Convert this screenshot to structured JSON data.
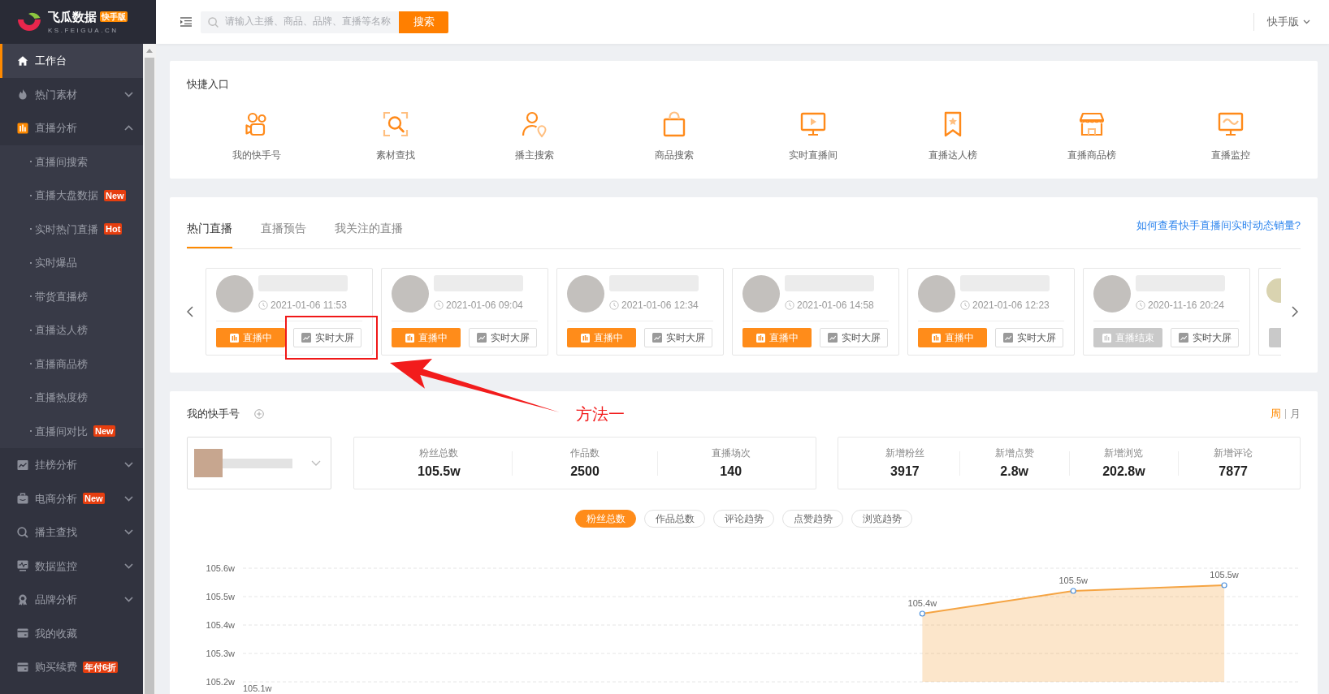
{
  "sidebar": {
    "brand": {
      "name": "飞瓜数据",
      "edition": "快手版",
      "domain": "KS.FEIGUA.CN"
    },
    "items": [
      {
        "kind": "link",
        "label": "工作台",
        "selected": true,
        "expanded": false
      },
      {
        "kind": "group",
        "label": "热门素材",
        "selected": false,
        "expanded": false
      },
      {
        "kind": "group",
        "label": "直播分析",
        "selected": false,
        "expanded": true,
        "children": [
          {
            "label": "直播间搜索",
            "selected": false
          },
          {
            "label": "直播大盘数据",
            "selected": false,
            "badge": "New"
          },
          {
            "label": "实时热门直播",
            "selected": false,
            "badge": "Hot"
          },
          {
            "label": "实时爆品",
            "selected": false
          },
          {
            "label": "带货直播榜",
            "selected": false
          },
          {
            "label": "直播达人榜",
            "selected": false
          },
          {
            "label": "直播商品榜",
            "selected": false
          },
          {
            "label": "直播热度榜",
            "selected": false
          },
          {
            "label": "直播间对比",
            "selected": false,
            "badge": "New"
          }
        ]
      },
      {
        "kind": "group",
        "label": "挂榜分析",
        "selected": false,
        "expanded": false
      },
      {
        "kind": "group",
        "label": "电商分析",
        "selected": false,
        "expanded": false,
        "badge": "New"
      },
      {
        "kind": "group",
        "label": "播主查找",
        "selected": false,
        "expanded": false
      },
      {
        "kind": "group",
        "label": "数据监控",
        "selected": false,
        "expanded": false
      },
      {
        "kind": "group",
        "label": "品牌分析",
        "selected": false,
        "expanded": false
      },
      {
        "kind": "link",
        "label": "我的收藏",
        "selected": false,
        "expanded": false
      },
      {
        "kind": "link",
        "label": "购买续费",
        "selected": false,
        "expanded": false,
        "badge": "年付6折"
      }
    ]
  },
  "topbar": {
    "search": {
      "placeholder": "请输入主播、商品、品牌、直播等名称"
    },
    "search_button": "搜索",
    "edition_menu": "快手版"
  },
  "quick_entry": {
    "title": "快捷入口",
    "items": [
      {
        "label": "我的快手号"
      },
      {
        "label": "素材查找"
      },
      {
        "label": "播主搜索"
      },
      {
        "label": "商品搜索"
      },
      {
        "label": "实时直播间"
      },
      {
        "label": "直播达人榜"
      },
      {
        "label": "直播商品榜"
      },
      {
        "label": "直播监控"
      }
    ]
  },
  "live_panel": {
    "tabs": [
      {
        "label": "热门直播",
        "selected": true
      },
      {
        "label": "直播预告",
        "selected": false
      },
      {
        "label": "我关注的直播",
        "selected": false
      }
    ],
    "help_link": "如何查看快手直播间实时动态销量?",
    "cards": [
      {
        "kind": "full",
        "time": "2021-01-06 11:53",
        "status": "直播中",
        "live": true,
        "screen_button": "实时大屏",
        "highlighted": true
      },
      {
        "kind": "full",
        "time": "2021-01-06 09:04",
        "status": "直播中",
        "live": true,
        "screen_button": "实时大屏",
        "highlighted": false
      },
      {
        "kind": "full",
        "time": "2021-01-06 12:34",
        "status": "直播中",
        "live": true,
        "screen_button": "实时大屏",
        "highlighted": false
      },
      {
        "kind": "full",
        "time": "2021-01-06 14:58",
        "status": "直播中",
        "live": true,
        "screen_button": "实时大屏",
        "highlighted": false
      },
      {
        "kind": "full",
        "time": "2021-01-06 12:23",
        "status": "直播中",
        "live": true,
        "screen_button": "实时大屏",
        "highlighted": false
      },
      {
        "kind": "full",
        "time": "2020-11-16 20:24",
        "status": "直播结束",
        "live": false,
        "screen_button": "实时大屏",
        "highlighted": false
      },
      {
        "kind": "cut",
        "live": false,
        "highlighted": false
      }
    ]
  },
  "annotation": {
    "text": "方法一"
  },
  "account_panel": {
    "title": "我的快手号",
    "periods": [
      {
        "label": "周",
        "selected": true
      },
      {
        "label": "月",
        "selected": false
      }
    ],
    "totals": [
      {
        "label": "粉丝总数",
        "value": "105.5w"
      },
      {
        "label": "作品数",
        "value": "2500"
      },
      {
        "label": "直播场次",
        "value": "140"
      }
    ],
    "increments": [
      {
        "label": "新增粉丝",
        "value": "3917"
      },
      {
        "label": "新增点赞",
        "value": "2.8w"
      },
      {
        "label": "新增浏览",
        "value": "202.8w"
      },
      {
        "label": "新增评论",
        "value": "7877"
      }
    ],
    "metric_tabs": [
      {
        "label": "粉丝总数",
        "selected": true
      },
      {
        "label": "作品总数",
        "selected": false
      },
      {
        "label": "评论趋势",
        "selected": false
      },
      {
        "label": "点赞趋势",
        "selected": false
      },
      {
        "label": "浏览趋势",
        "selected": false
      }
    ],
    "chart_data": {
      "type": "area",
      "series": [
        {
          "color": "#f5a443",
          "values": [
            null,
            null,
            null,
            null,
            105.44,
            105.52,
            105.54
          ]
        }
      ],
      "ylim": [
        105.2,
        105.6
      ],
      "yticks": [
        {
          "value": 105.2,
          "label": "105.2w"
        },
        {
          "value": 105.3,
          "label": "105.3w"
        },
        {
          "value": 105.4,
          "label": "105.4w"
        },
        {
          "value": 105.5,
          "label": "105.5w"
        },
        {
          "value": 105.6,
          "label": "105.6w"
        }
      ],
      "grid": true,
      "value_labels": [
        null,
        null,
        null,
        null,
        "105.4w",
        "105.5w",
        "105.5w"
      ],
      "annotations": [
        "105.1w"
      ]
    }
  }
}
